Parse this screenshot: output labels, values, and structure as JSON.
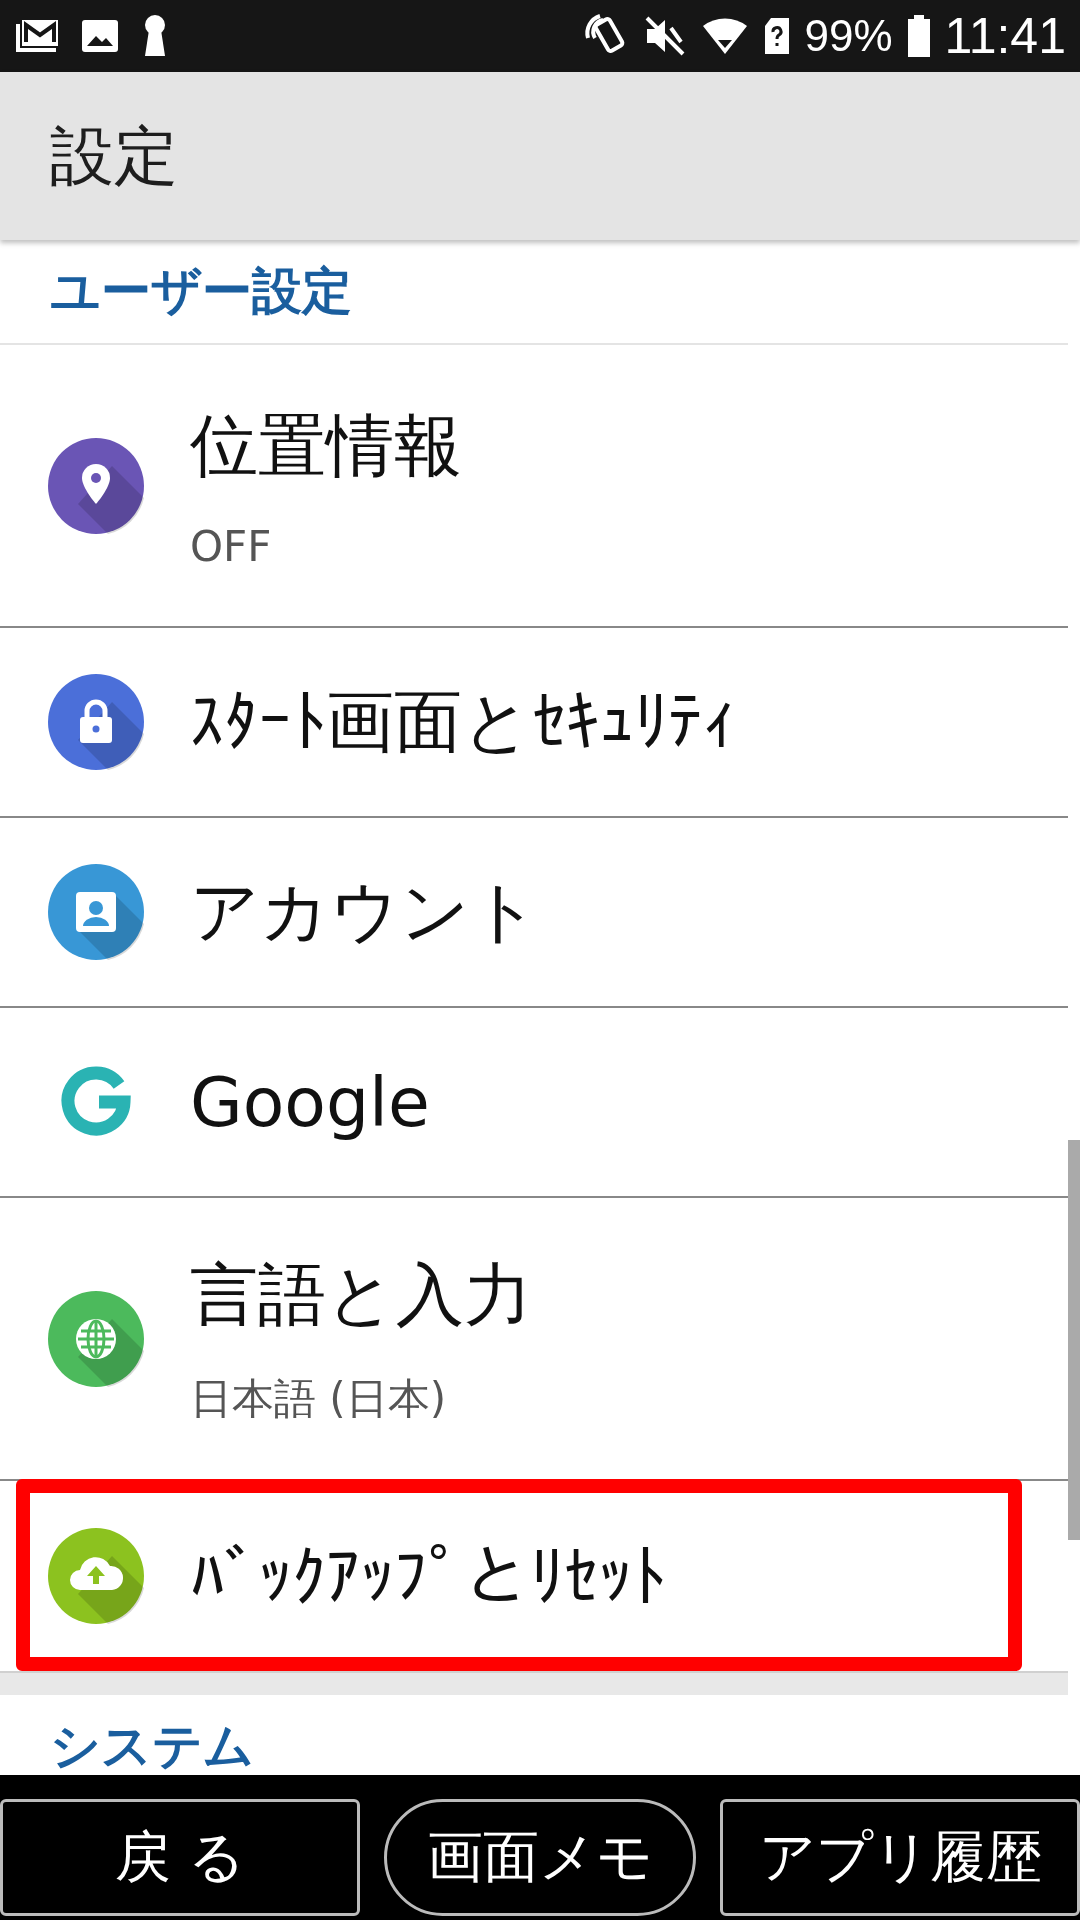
{
  "status_bar": {
    "battery": "99%",
    "time": "11:41"
  },
  "header": {
    "title": "設定"
  },
  "sections": [
    {
      "title": "ユーザー設定",
      "items": [
        {
          "title": "位置情報",
          "summary": "OFF",
          "kind": "location",
          "color": "#6a55b5",
          "highlighted": false
        },
        {
          "title": "ｽﾀｰﾄ画面とｾｷｭﾘﾃｨ",
          "kind": "lock",
          "color": "#4b6fd9",
          "highlighted": false
        },
        {
          "title": "アカウント",
          "kind": "account",
          "color": "#3897d6",
          "highlighted": false
        },
        {
          "title": "Google",
          "kind": "google",
          "color": "#2ab3b3",
          "highlighted": false
        },
        {
          "title": "言語と入力",
          "summary": "日本語 (日本)",
          "kind": "globe",
          "color": "#4cba5c",
          "highlighted": false
        },
        {
          "title": "ﾊﾞｯｸｱｯﾌﾟとﾘｾｯﾄ",
          "kind": "cloud",
          "color": "#8cc21f",
          "highlighted": true
        }
      ]
    },
    {
      "title": "システム"
    }
  ],
  "nav_buttons": [
    {
      "label": "戻 る",
      "kind": "square"
    },
    {
      "label": "画面メモ",
      "kind": "pill"
    },
    {
      "label": "アプリ履歴",
      "kind": "square"
    }
  ]
}
